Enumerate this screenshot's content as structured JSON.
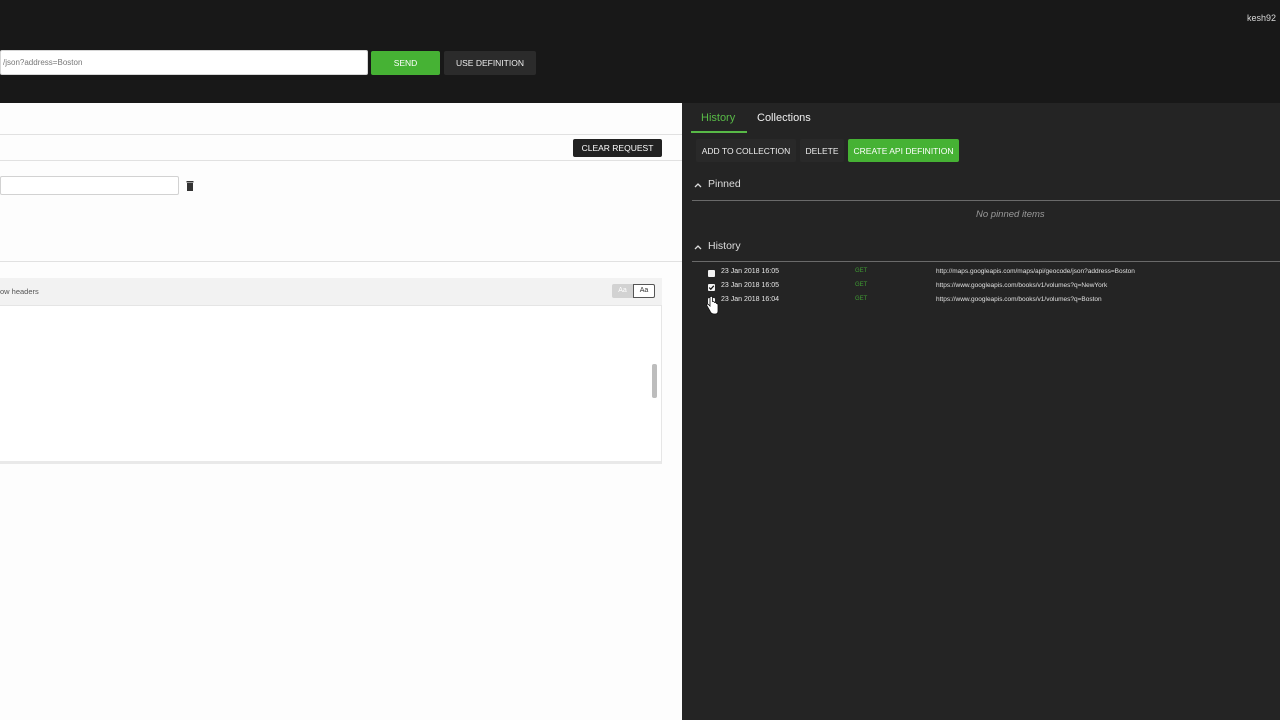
{
  "topbar": {
    "user": "kesh92",
    "url_value": "/json?address=Boston",
    "send_label": "SEND",
    "use_definition_label": "USE DEFINITION"
  },
  "request": {
    "clear_label": "CLEAR REQUEST",
    "show_headers_label": "ow headers",
    "case_toggle": [
      "Aa",
      "Aa"
    ]
  },
  "sidebar": {
    "tabs": [
      {
        "label": "History",
        "active": true
      },
      {
        "label": "Collections",
        "active": false
      }
    ],
    "add_to_collection_label": "ADD TO COLLECTION",
    "delete_label": "DELETE",
    "create_api_label": "CREATE API DEFINITION",
    "pinned": {
      "title": "Pinned",
      "empty": "No pinned items"
    },
    "history": {
      "title": "History",
      "items": [
        {
          "date": "23 Jan 2018 16:05",
          "method": "GET",
          "url": "http://maps.googleapis.com/maps/api/geocode/json?address=Boston",
          "checked": false
        },
        {
          "date": "23 Jan 2018 16:05",
          "method": "GET",
          "url": "https://www.googleapis.com/books/v1/volumes?q=NewYork",
          "checked": true
        },
        {
          "date": "23 Jan 2018 16:04",
          "method": "GET",
          "url": "https://www.googleapis.com/books/v1/volumes?q=Boston",
          "checked": false
        }
      ]
    }
  },
  "colors": {
    "accent_green": "#46b234",
    "panel_dark": "#242424",
    "topbar": "#181818"
  }
}
